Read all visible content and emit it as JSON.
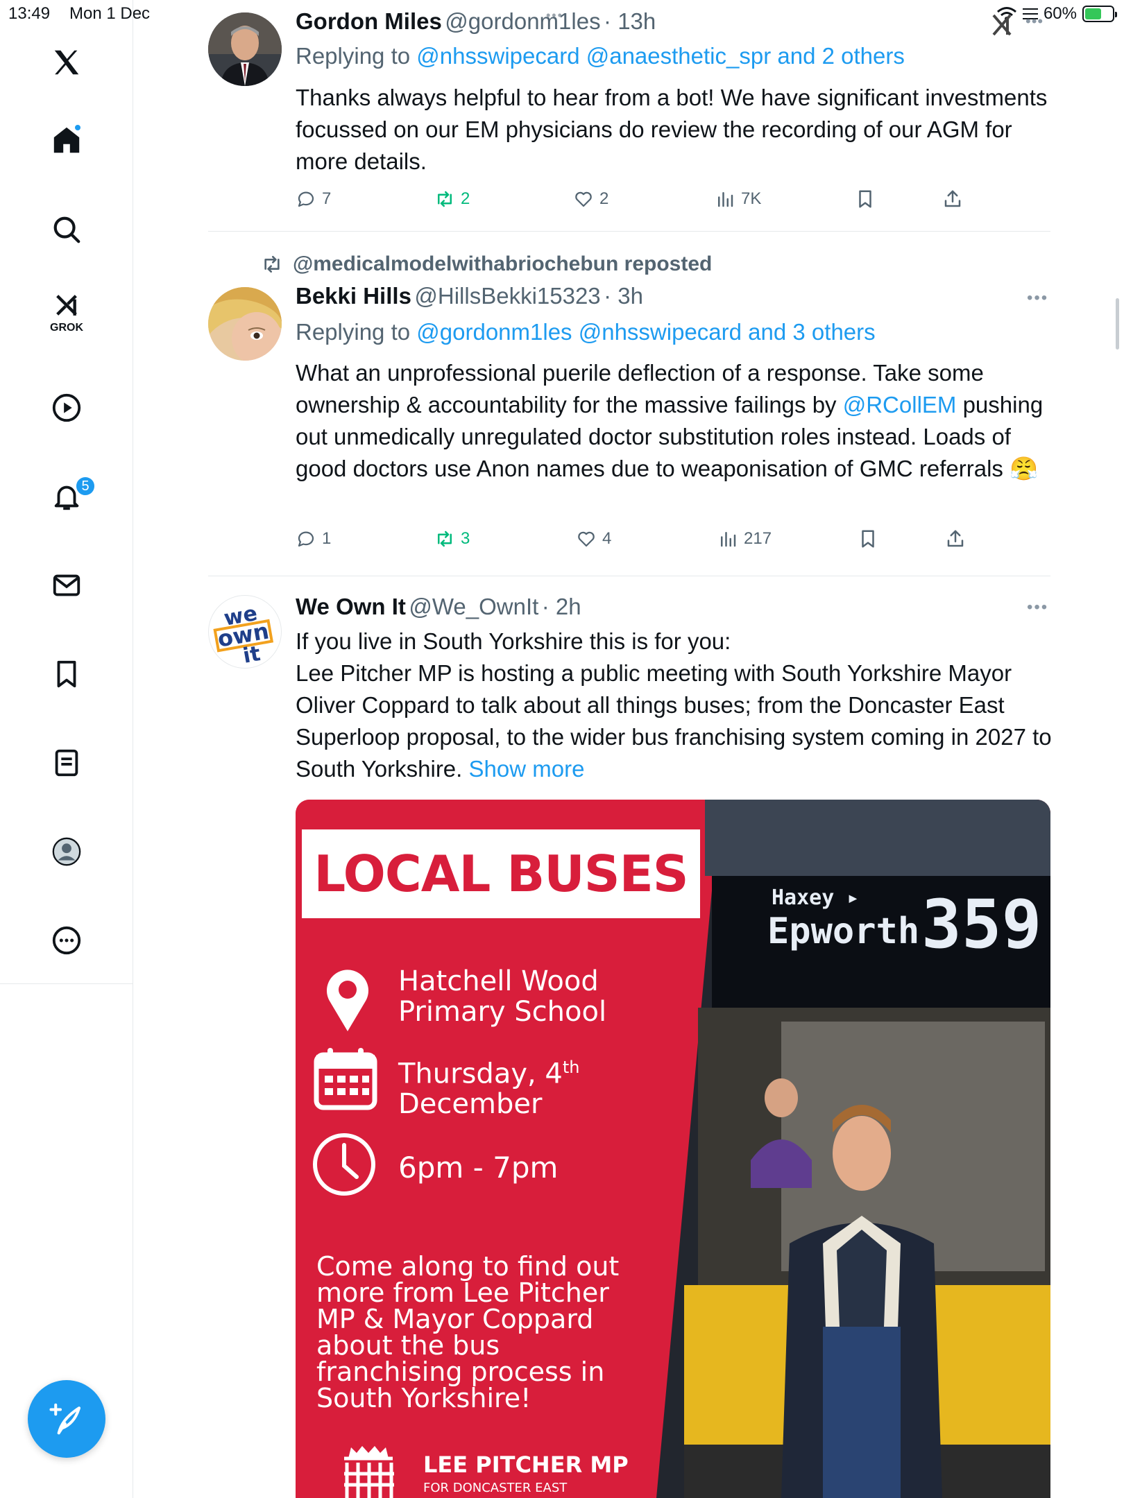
{
  "status_bar": {
    "time": "13:49",
    "date": "Mon 1 Dec",
    "battery": "60%",
    "battery_level": 0.6
  },
  "sidebar": {
    "logo_icon": "x-logo-icon",
    "items": [
      {
        "name": "home",
        "icon": "home-icon"
      },
      {
        "name": "explore",
        "icon": "search-icon"
      },
      {
        "name": "grok",
        "icon": "grok-icon",
        "label": "GROK"
      },
      {
        "name": "video",
        "icon": "play-icon"
      },
      {
        "name": "notifications",
        "icon": "bell-icon",
        "badge": "5"
      },
      {
        "name": "messages",
        "icon": "mail-icon"
      },
      {
        "name": "bookmarks",
        "icon": "bookmark-icon"
      },
      {
        "name": "articles",
        "icon": "article-icon"
      },
      {
        "name": "profile",
        "icon": "profile-icon"
      },
      {
        "name": "more",
        "icon": "more-icon"
      }
    ],
    "compose_icon": "compose-icon"
  },
  "tweets": [
    {
      "name": "Gordon Miles",
      "handle": "@gordonm1les",
      "time": "· 13h",
      "reply_prefix": "Replying to",
      "reply_links": "@nhsswipecard @anaesthetic_spr and 2 others",
      "body": "Thanks always helpful to hear from a bot! We have significant investments focussed on our EM physicians do review the recording of our AGM for more details.",
      "replies": "7",
      "reposts": "2",
      "likes": "2",
      "views": "7K"
    },
    {
      "repost_by": "@medicalmodelwithabriochebun reposted",
      "name": "Bekki Hills",
      "handle": "@HillsBekki15323",
      "time": "· 3h",
      "reply_prefix": "Replying to",
      "reply_links": "@gordonm1les @nhsswipecard and 3 others",
      "body_start": "What an unprofessional puerile deflection of a response. Take some ownership & accountability for the massive failings by ",
      "body_mention": "@RCollEM",
      "body_end": " pushing out unmedically unregulated doctor substitution roles instead. Loads of good doctors use Anon names due to weaponisation of GMC referrals 😤",
      "replies": "1",
      "reposts": "3",
      "likes": "4",
      "views": "217"
    },
    {
      "name": "We Own It",
      "handle": "@We_OwnIt",
      "time": "· 2h",
      "avatar_text": [
        "we",
        "own",
        "it"
      ],
      "body_line1": "If you live in South Yorkshire this is for you:",
      "body_rest": "Lee Pitcher MP is hosting a public meeting with South Yorkshire Mayor Oliver Coppard to talk about all things buses; from the Doncaster East Superloop proposal, to the wider bus franchising system coming in 2027 to South Yorkshire.",
      "show_more": "Show more",
      "poster": {
        "title": "LOCAL BUSES",
        "location": "Hatchell Wood Primary School",
        "date_day": "Thursday, 4",
        "date_suffix": "th",
        "date_month": "December",
        "time": "6pm - 7pm",
        "description": "Come along to find out more from Lee Pitcher MP & Mayor Coppard about the bus franchising process in South Yorkshire!",
        "mp_name": "LEE PITCHER MP",
        "mp_constituency": "FOR DONCASTER EAST",
        "bus_destination_top": "Haxey ▸",
        "bus_destination": "Epworth",
        "bus_number": "359"
      }
    }
  ]
}
